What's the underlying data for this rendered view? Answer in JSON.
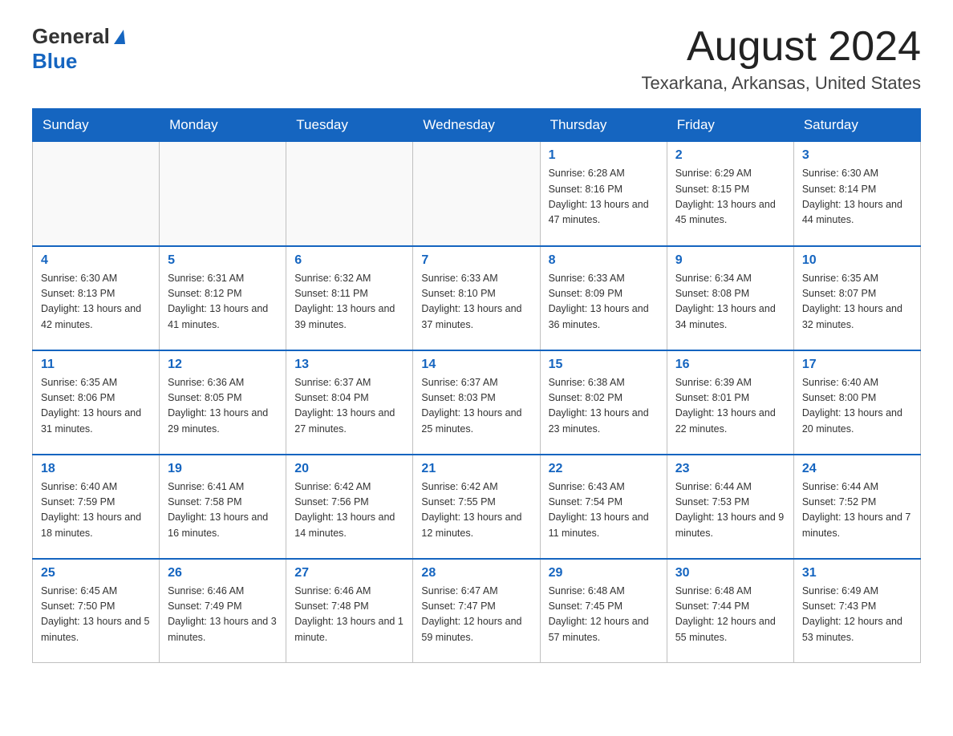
{
  "header": {
    "logo_general": "General",
    "logo_blue": "Blue",
    "month_title": "August 2024",
    "location": "Texarkana, Arkansas, United States"
  },
  "weekdays": [
    "Sunday",
    "Monday",
    "Tuesday",
    "Wednesday",
    "Thursday",
    "Friday",
    "Saturday"
  ],
  "weeks": [
    [
      {
        "day": "",
        "info": ""
      },
      {
        "day": "",
        "info": ""
      },
      {
        "day": "",
        "info": ""
      },
      {
        "day": "",
        "info": ""
      },
      {
        "day": "1",
        "info": "Sunrise: 6:28 AM\nSunset: 8:16 PM\nDaylight: 13 hours and 47 minutes."
      },
      {
        "day": "2",
        "info": "Sunrise: 6:29 AM\nSunset: 8:15 PM\nDaylight: 13 hours and 45 minutes."
      },
      {
        "day": "3",
        "info": "Sunrise: 6:30 AM\nSunset: 8:14 PM\nDaylight: 13 hours and 44 minutes."
      }
    ],
    [
      {
        "day": "4",
        "info": "Sunrise: 6:30 AM\nSunset: 8:13 PM\nDaylight: 13 hours and 42 minutes."
      },
      {
        "day": "5",
        "info": "Sunrise: 6:31 AM\nSunset: 8:12 PM\nDaylight: 13 hours and 41 minutes."
      },
      {
        "day": "6",
        "info": "Sunrise: 6:32 AM\nSunset: 8:11 PM\nDaylight: 13 hours and 39 minutes."
      },
      {
        "day": "7",
        "info": "Sunrise: 6:33 AM\nSunset: 8:10 PM\nDaylight: 13 hours and 37 minutes."
      },
      {
        "day": "8",
        "info": "Sunrise: 6:33 AM\nSunset: 8:09 PM\nDaylight: 13 hours and 36 minutes."
      },
      {
        "day": "9",
        "info": "Sunrise: 6:34 AM\nSunset: 8:08 PM\nDaylight: 13 hours and 34 minutes."
      },
      {
        "day": "10",
        "info": "Sunrise: 6:35 AM\nSunset: 8:07 PM\nDaylight: 13 hours and 32 minutes."
      }
    ],
    [
      {
        "day": "11",
        "info": "Sunrise: 6:35 AM\nSunset: 8:06 PM\nDaylight: 13 hours and 31 minutes."
      },
      {
        "day": "12",
        "info": "Sunrise: 6:36 AM\nSunset: 8:05 PM\nDaylight: 13 hours and 29 minutes."
      },
      {
        "day": "13",
        "info": "Sunrise: 6:37 AM\nSunset: 8:04 PM\nDaylight: 13 hours and 27 minutes."
      },
      {
        "day": "14",
        "info": "Sunrise: 6:37 AM\nSunset: 8:03 PM\nDaylight: 13 hours and 25 minutes."
      },
      {
        "day": "15",
        "info": "Sunrise: 6:38 AM\nSunset: 8:02 PM\nDaylight: 13 hours and 23 minutes."
      },
      {
        "day": "16",
        "info": "Sunrise: 6:39 AM\nSunset: 8:01 PM\nDaylight: 13 hours and 22 minutes."
      },
      {
        "day": "17",
        "info": "Sunrise: 6:40 AM\nSunset: 8:00 PM\nDaylight: 13 hours and 20 minutes."
      }
    ],
    [
      {
        "day": "18",
        "info": "Sunrise: 6:40 AM\nSunset: 7:59 PM\nDaylight: 13 hours and 18 minutes."
      },
      {
        "day": "19",
        "info": "Sunrise: 6:41 AM\nSunset: 7:58 PM\nDaylight: 13 hours and 16 minutes."
      },
      {
        "day": "20",
        "info": "Sunrise: 6:42 AM\nSunset: 7:56 PM\nDaylight: 13 hours and 14 minutes."
      },
      {
        "day": "21",
        "info": "Sunrise: 6:42 AM\nSunset: 7:55 PM\nDaylight: 13 hours and 12 minutes."
      },
      {
        "day": "22",
        "info": "Sunrise: 6:43 AM\nSunset: 7:54 PM\nDaylight: 13 hours and 11 minutes."
      },
      {
        "day": "23",
        "info": "Sunrise: 6:44 AM\nSunset: 7:53 PM\nDaylight: 13 hours and 9 minutes."
      },
      {
        "day": "24",
        "info": "Sunrise: 6:44 AM\nSunset: 7:52 PM\nDaylight: 13 hours and 7 minutes."
      }
    ],
    [
      {
        "day": "25",
        "info": "Sunrise: 6:45 AM\nSunset: 7:50 PM\nDaylight: 13 hours and 5 minutes."
      },
      {
        "day": "26",
        "info": "Sunrise: 6:46 AM\nSunset: 7:49 PM\nDaylight: 13 hours and 3 minutes."
      },
      {
        "day": "27",
        "info": "Sunrise: 6:46 AM\nSunset: 7:48 PM\nDaylight: 13 hours and 1 minute."
      },
      {
        "day": "28",
        "info": "Sunrise: 6:47 AM\nSunset: 7:47 PM\nDaylight: 12 hours and 59 minutes."
      },
      {
        "day": "29",
        "info": "Sunrise: 6:48 AM\nSunset: 7:45 PM\nDaylight: 12 hours and 57 minutes."
      },
      {
        "day": "30",
        "info": "Sunrise: 6:48 AM\nSunset: 7:44 PM\nDaylight: 12 hours and 55 minutes."
      },
      {
        "day": "31",
        "info": "Sunrise: 6:49 AM\nSunset: 7:43 PM\nDaylight: 12 hours and 53 minutes."
      }
    ]
  ]
}
